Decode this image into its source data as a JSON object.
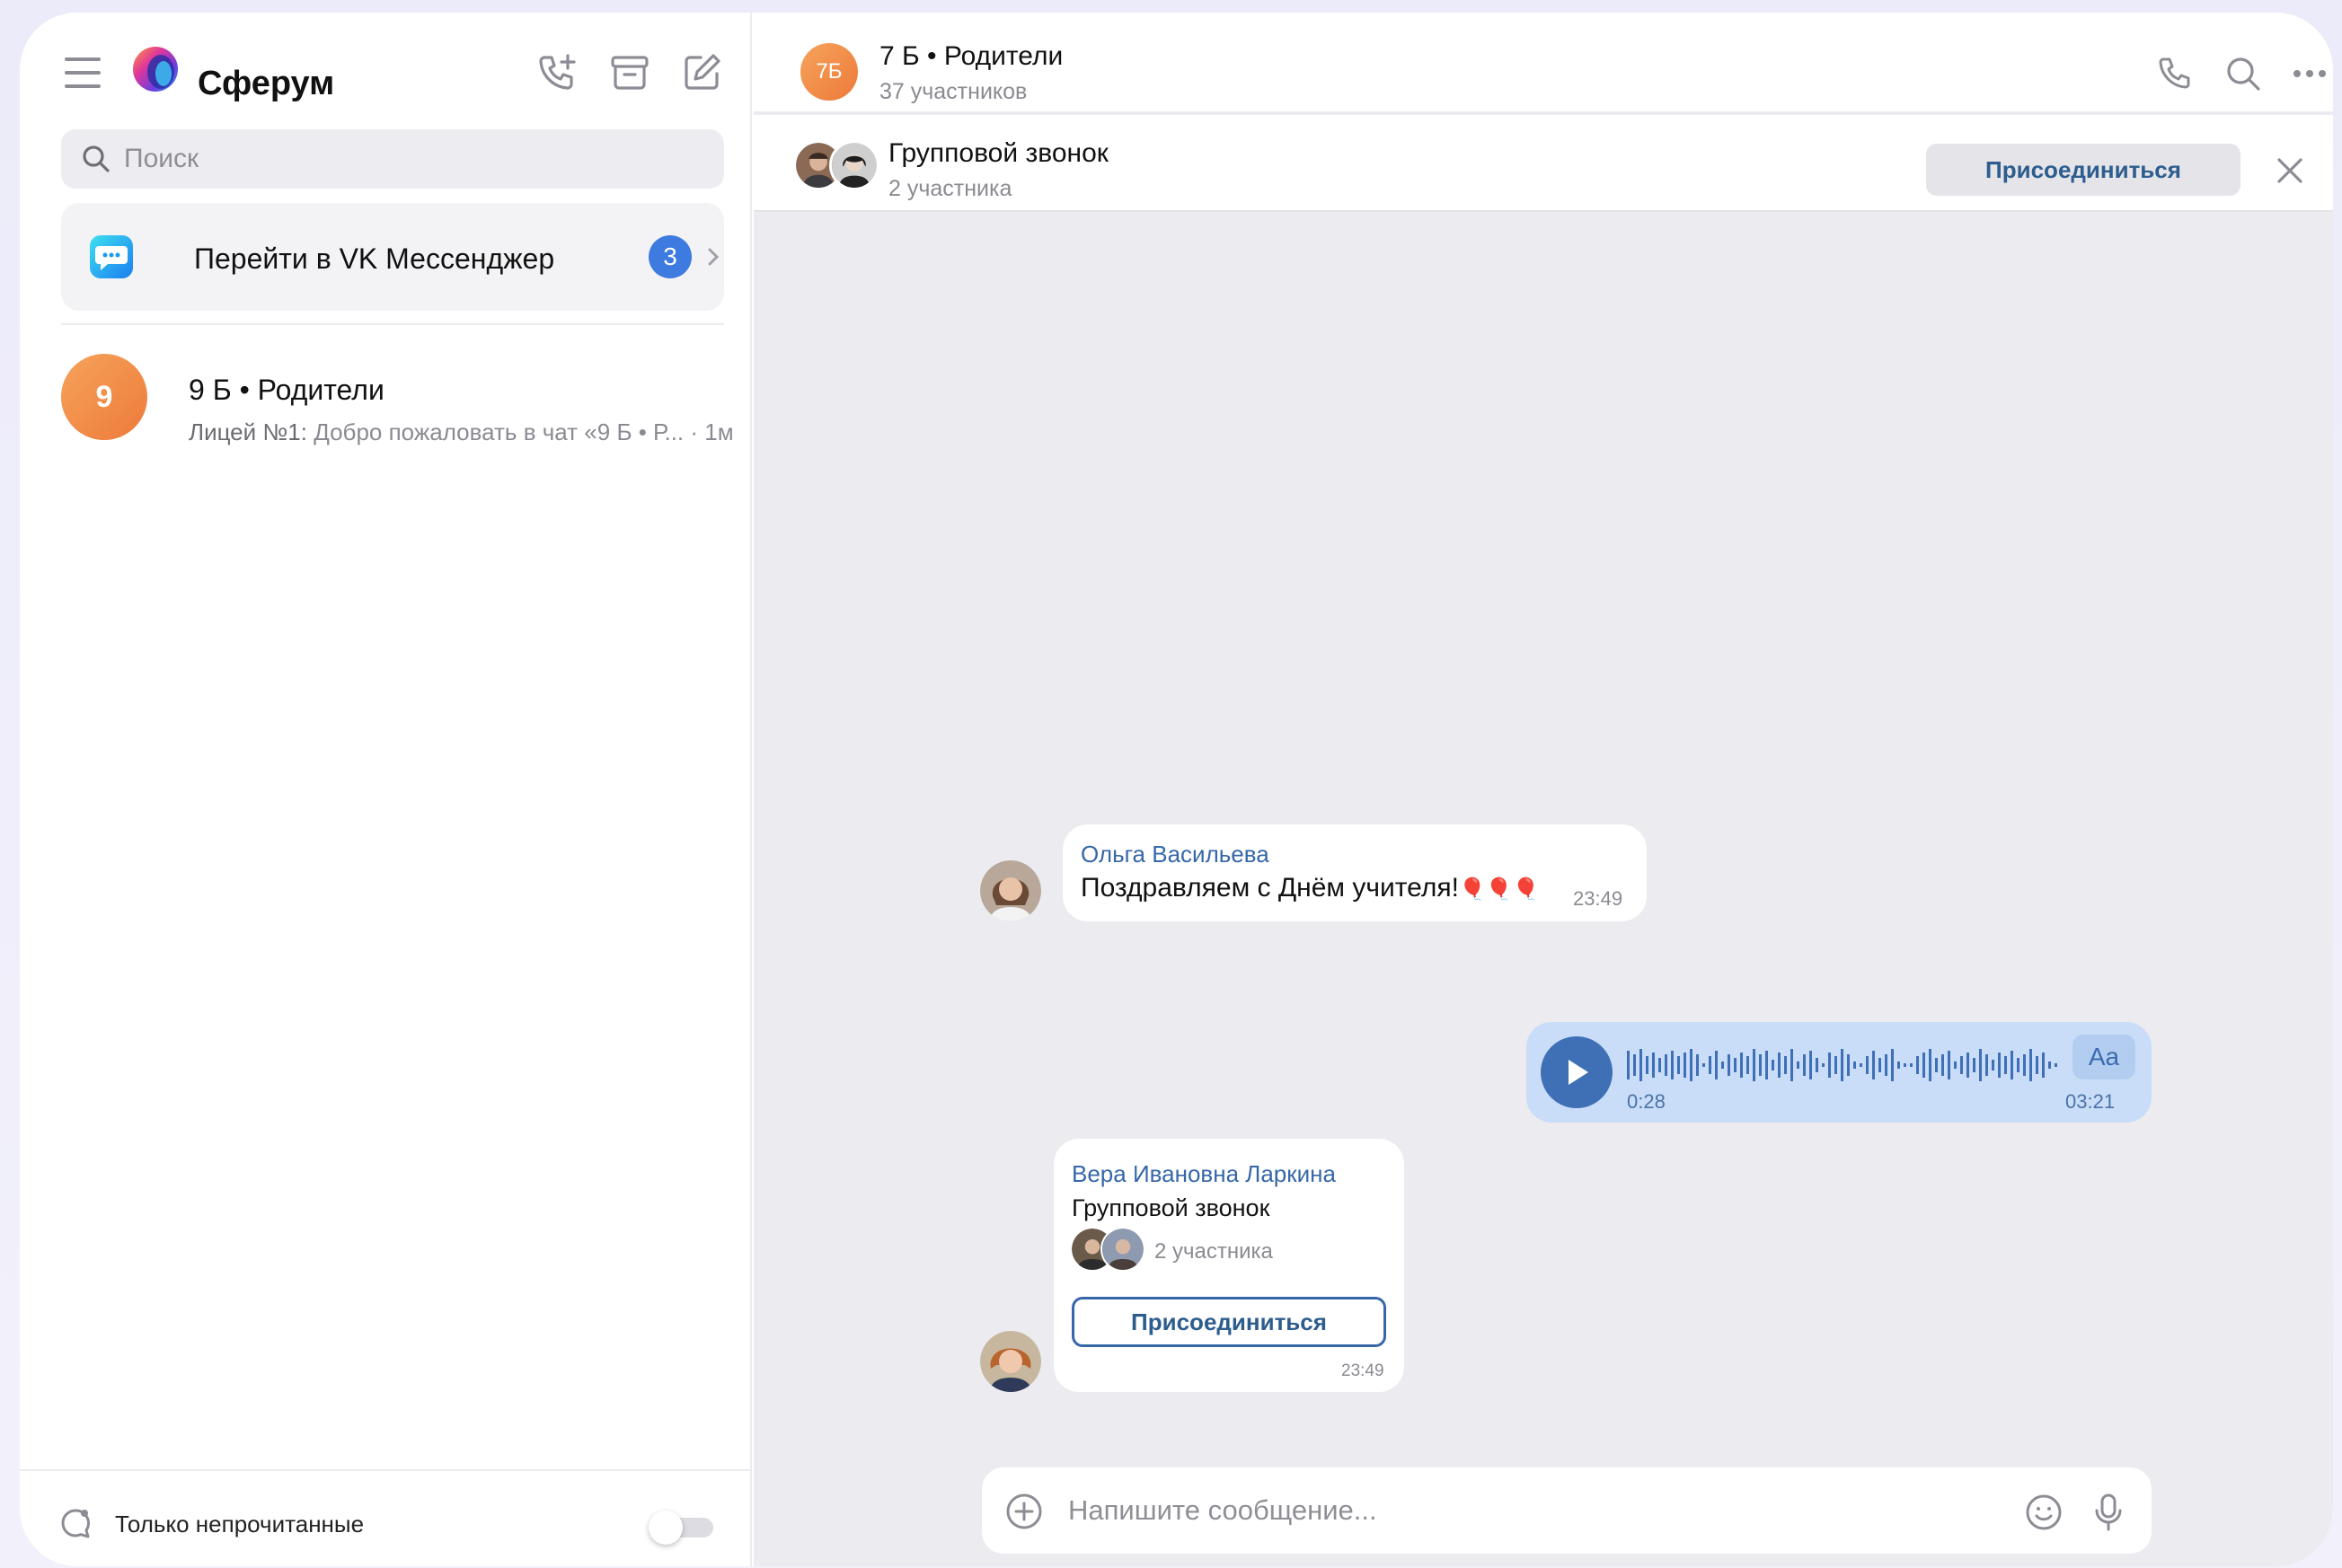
{
  "app": {
    "brand": "Сферум",
    "colors": {
      "accent": "#3d7be0",
      "link": "#3667a8",
      "voice_bg": "#c9ddf8",
      "avatar_orange": "#ee7a3a"
    }
  },
  "sidebar": {
    "search": {
      "placeholder": "Поиск"
    },
    "vk_promo": {
      "label": "Перейти в VK Мессенджер",
      "badge": "3"
    },
    "chats": [
      {
        "avatar_text": "9",
        "title": "9 Б • Родители",
        "preview_author": "Лицей №1:",
        "preview_text": " Добро пожаловать в чат «9 Б • Р...",
        "time": " · 1м"
      }
    ],
    "footer": {
      "unread_only_label": "Только непрочитанные",
      "unread_only_enabled": false
    }
  },
  "chat": {
    "avatar_text": "7Б",
    "title": "7 Б • Родители",
    "subtitle": "37 участников",
    "call_banner": {
      "title": "Групповой звонок",
      "subtitle": "2 участника",
      "join_label": "Присоединиться"
    },
    "messages": [
      {
        "sender": "Ольга Васильева",
        "text": "Поздравляем с Днём учителя!",
        "emoji": "🎈🎈🎈",
        "time": "23:49"
      },
      {
        "type": "voice",
        "current": "0:28",
        "duration": "03:21",
        "transcribe_label": "Aa"
      },
      {
        "sender": "Вера Ивановна Ларкина",
        "call_title": "Групповой звонок",
        "participants": "2 участника",
        "join_label": "Присоединиться",
        "time": "23:49"
      }
    ],
    "composer": {
      "placeholder": "Напишите сообщение..."
    }
  }
}
